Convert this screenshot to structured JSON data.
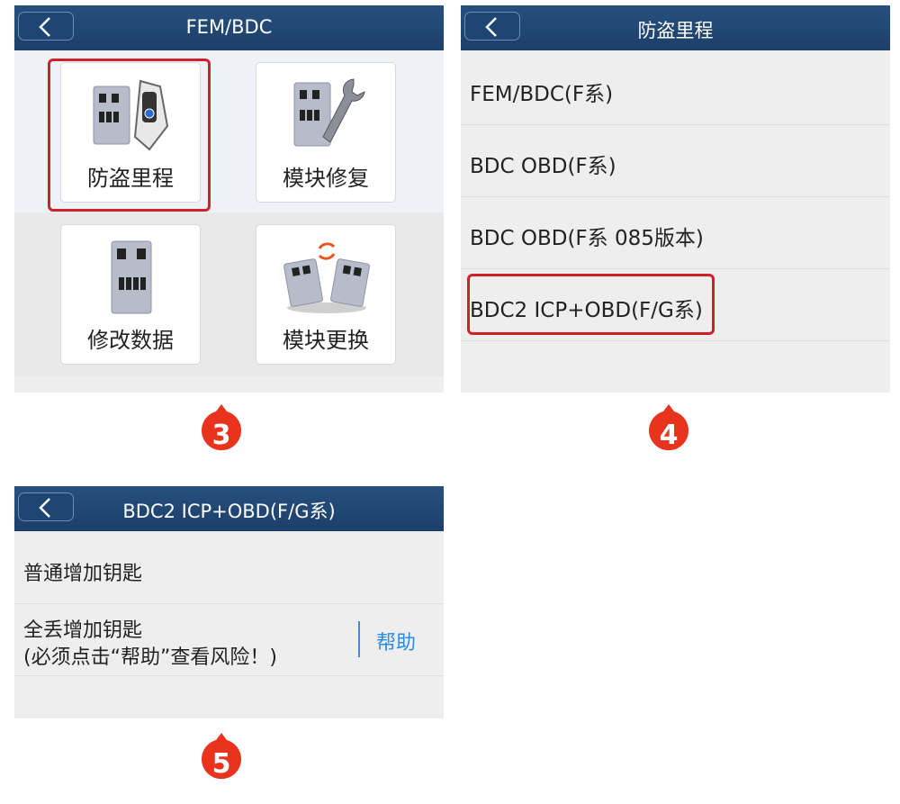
{
  "panel3": {
    "title": "FEM/BDC",
    "tiles": [
      {
        "label": "防盗里程",
        "icon": "module-key-icon"
      },
      {
        "label": "模块修复",
        "icon": "module-wrench-icon"
      },
      {
        "label": "修改数据",
        "icon": "module-icon"
      },
      {
        "label": "模块更换",
        "icon": "module-swap-icon"
      }
    ],
    "step": "3"
  },
  "panel4": {
    "title": "防盗里程",
    "items": [
      "FEM/BDC(F系)",
      "BDC OBD(F系)",
      "BDC OBD(F系 085版本)",
      "BDC2 ICP+OBD(F/G系)"
    ],
    "step": "4"
  },
  "panel5": {
    "title": "BDC2 ICP+OBD(F/G系)",
    "item1": "普通增加钥匙",
    "item2_line1": "全丢增加钥匙",
    "item2_line2": "(必须点击“帮助”查看风险！)",
    "help": "帮助",
    "step": "5"
  },
  "colors": {
    "titlebar": "#1f4673",
    "highlight": "#d0202a",
    "badge": "#e8341c",
    "link": "#2a8de0"
  }
}
